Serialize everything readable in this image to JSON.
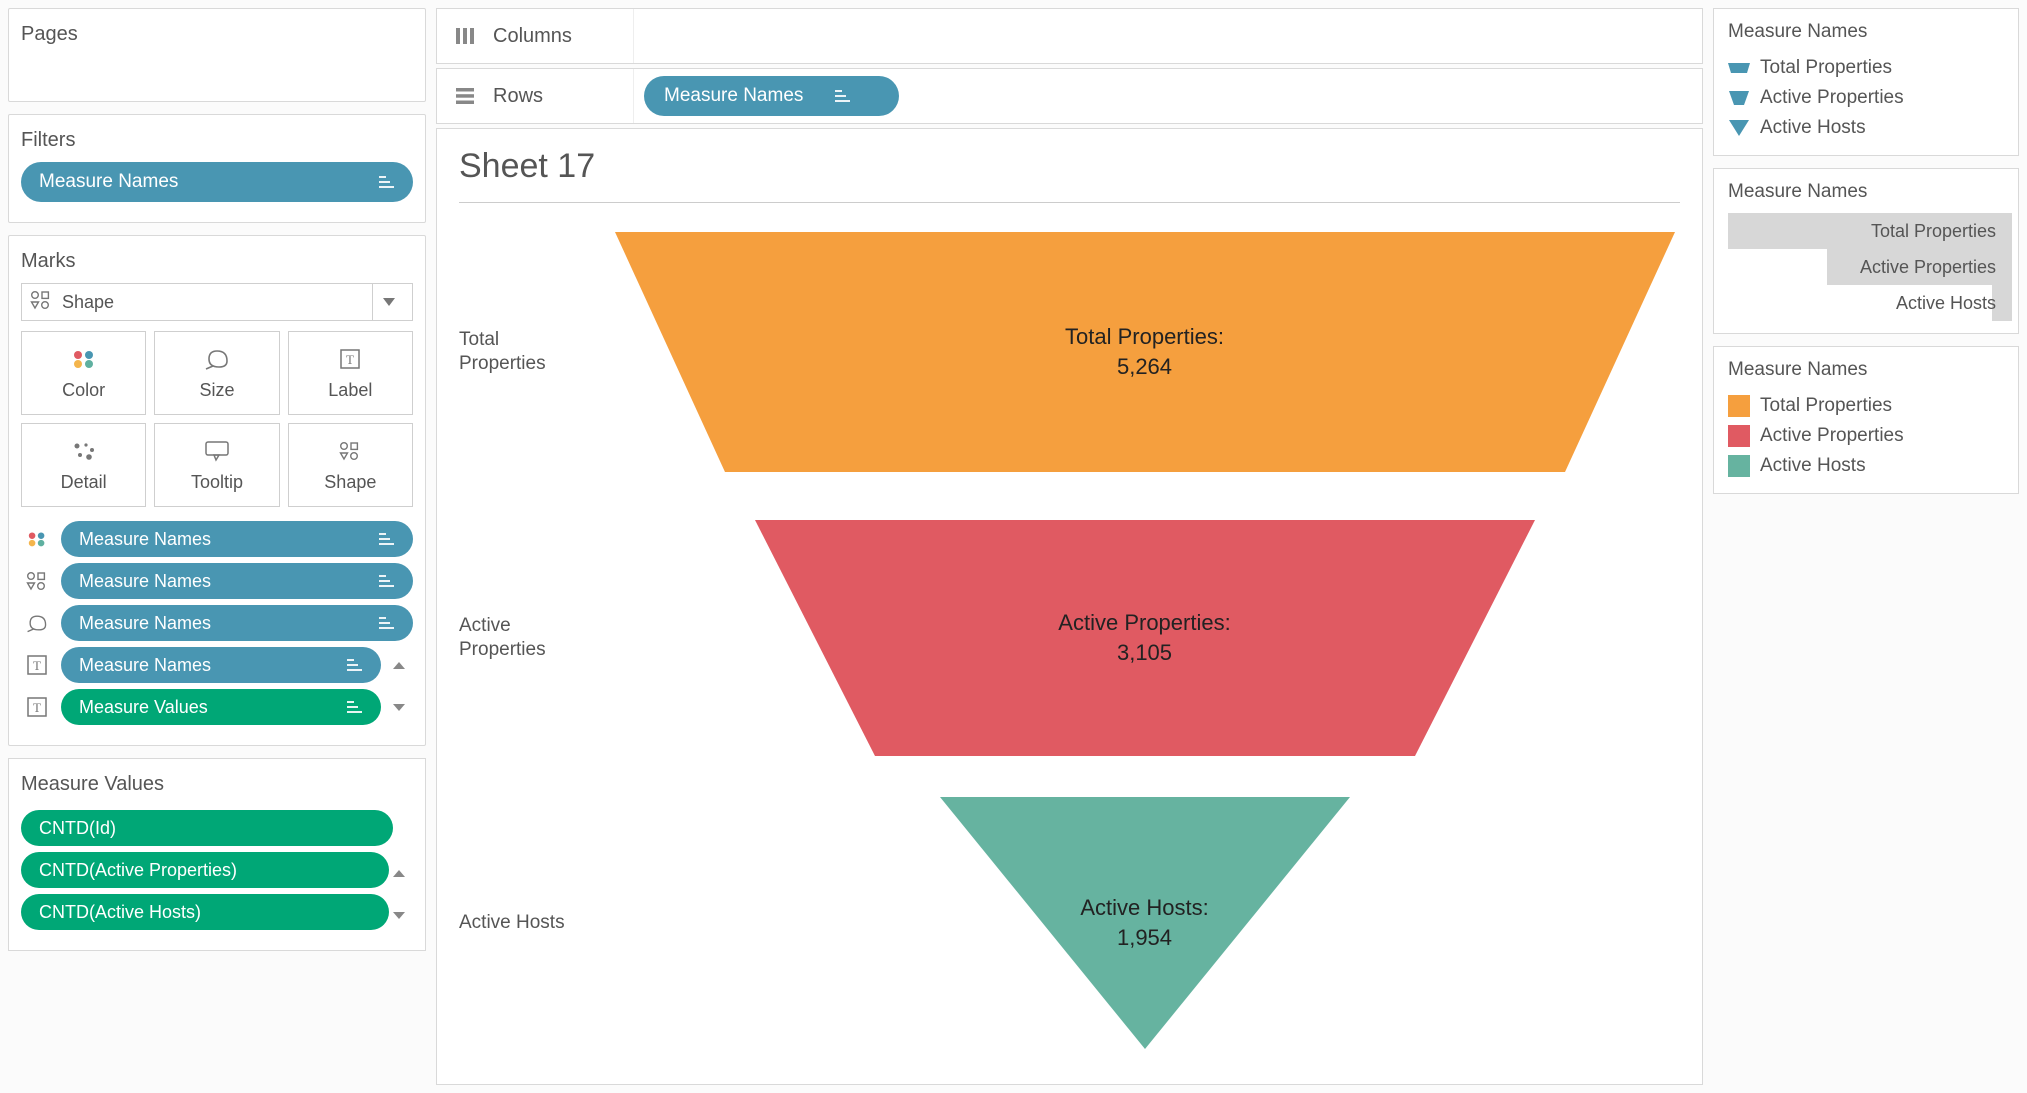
{
  "pages": {
    "title": "Pages"
  },
  "filters": {
    "title": "Filters",
    "pill": "Measure Names"
  },
  "marks": {
    "title": "Marks",
    "type": "Shape",
    "cells": {
      "color": "Color",
      "size": "Size",
      "label": "Label",
      "detail": "Detail",
      "tooltip": "Tooltip",
      "shape": "Shape"
    },
    "assignments": [
      {
        "icon": "color",
        "label": "Measure Names",
        "color": "blue"
      },
      {
        "icon": "shape",
        "label": "Measure Names",
        "color": "blue"
      },
      {
        "icon": "size",
        "label": "Measure Names",
        "color": "blue"
      },
      {
        "icon": "text",
        "label": "Measure Names",
        "color": "blue"
      },
      {
        "icon": "text",
        "label": "Measure Values",
        "color": "green"
      }
    ]
  },
  "measure_values": {
    "title": "Measure Values",
    "pills": [
      "CNTD(Id)",
      "CNTD(Active Properties)",
      "CNTD(Active Hosts)"
    ]
  },
  "shelves": {
    "columns": "Columns",
    "rows": "Rows",
    "rows_pill": "Measure Names"
  },
  "sheet": {
    "title": "Sheet 17",
    "rows": [
      {
        "label": "Total\nProperties",
        "title": "Total Properties:",
        "value": "5,264",
        "color": "#f59f3e",
        "top": 1060,
        "bottom": 840
      },
      {
        "label": "Active\nProperties",
        "title": "Active Properties:",
        "value": "3,105",
        "color": "#e05a62",
        "top": 780,
        "bottom": 540
      },
      {
        "label": "Active Hosts",
        "title": "Active Hosts:",
        "value": "1,954",
        "color": "#66b3a0",
        "top": 410,
        "bottom": 0
      }
    ]
  },
  "legends": {
    "shape": {
      "title": "Measure Names",
      "items": [
        {
          "label": "Total Properties"
        },
        {
          "label": "Active Properties"
        },
        {
          "label": "Active Hosts"
        }
      ]
    },
    "size": {
      "title": "Measure Names",
      "items": [
        {
          "label": "Total Properties",
          "frac": 1.0
        },
        {
          "label": "Active Properties",
          "frac": 0.55
        },
        {
          "label": "Active Hosts",
          "frac": 0.08
        }
      ]
    },
    "color": {
      "title": "Measure Names",
      "items": [
        {
          "label": "Total Properties",
          "color": "#f59f3e"
        },
        {
          "label": "Active Properties",
          "color": "#e05a62"
        },
        {
          "label": "Active Hosts",
          "color": "#66b3a0"
        }
      ]
    }
  },
  "chart_data": {
    "type": "bar",
    "title": "Sheet 17",
    "categories": [
      "Total Properties",
      "Active Properties",
      "Active Hosts"
    ],
    "values": [
      5264,
      3105,
      1954
    ],
    "xlabel": "",
    "ylabel": "",
    "ylim": [
      0,
      5264
    ]
  }
}
